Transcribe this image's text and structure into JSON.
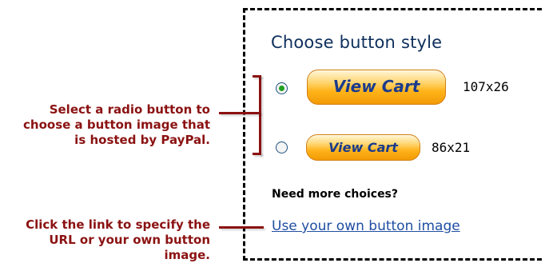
{
  "panel": {
    "title": "Choose button style",
    "options": [
      {
        "button_label": "View Cart",
        "size": "107x26",
        "selected": true
      },
      {
        "button_label": "View Cart",
        "size": "86x21",
        "selected": false
      }
    ],
    "more_choices": "Need more choices?",
    "own_image_link": "Use your own button image"
  },
  "callouts": {
    "radio_text": "Select a radio button to choose a button image that is hosted by PayPal.",
    "link_text": "Click the link to specify the URL or your own button image."
  },
  "colors": {
    "callout": "#8b1212",
    "title": "#0e2f5c",
    "link": "#1f4ea1",
    "button_orange": "#ffb31a",
    "button_text": "#1a3b8c"
  }
}
